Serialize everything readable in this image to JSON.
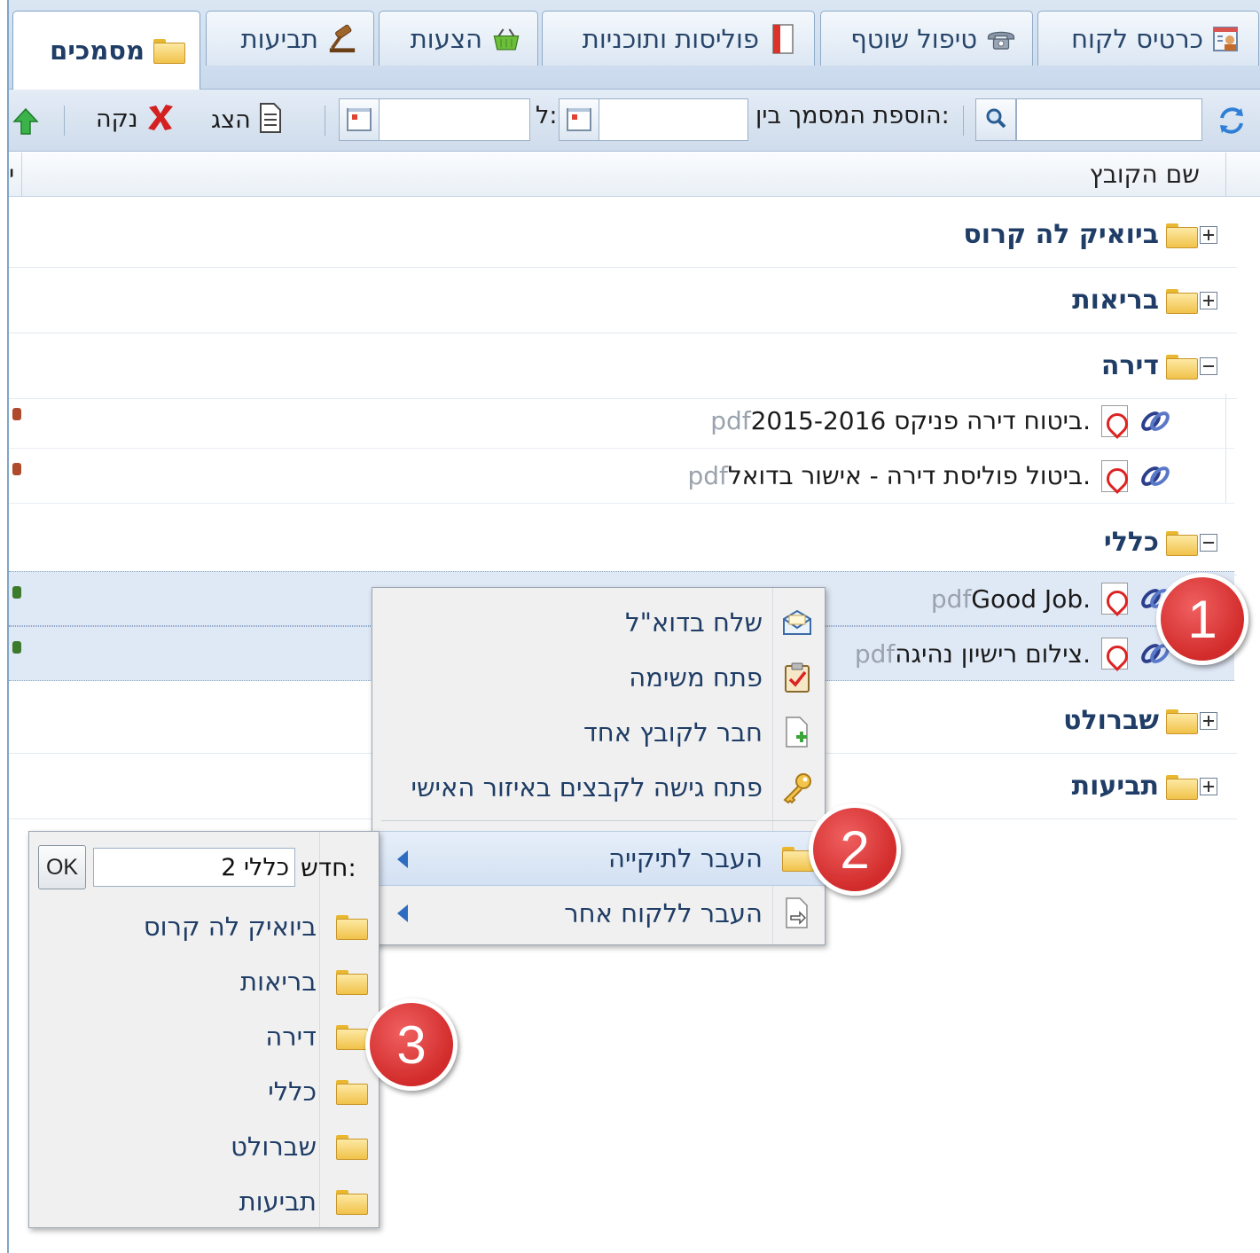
{
  "tabs": [
    {
      "label": "כרטיס לקוח",
      "icon": "customer-card-icon"
    },
    {
      "label": "טיפול שוטף",
      "icon": "phone-icon"
    },
    {
      "label": "פוליסות ותוכניות",
      "icon": "policy-book-icon"
    },
    {
      "label": "הצעות",
      "icon": "basket-icon"
    },
    {
      "label": "תביעות",
      "icon": "gavel-icon"
    },
    {
      "label": "מסמכים",
      "icon": "folder-icon",
      "active": true
    }
  ],
  "toolbar": {
    "date_range_label": "הוספת המסמך בין:",
    "to_label": "ל:",
    "show_label": "הצג",
    "clear_label": "נקה",
    "search_value": "",
    "from_date": "",
    "to_date": ""
  },
  "grid": {
    "column_title": "שם הקובץ",
    "left_column_fragment": "‫י‬"
  },
  "folders": [
    {
      "name": "ביואיק לה קרוס",
      "expanded": false
    },
    {
      "name": "בריאות",
      "expanded": false
    },
    {
      "name": "דירה",
      "expanded": true,
      "files": [
        {
          "name": "ביטוח דירה פניקס 2015-2016.",
          "ext": "pdf"
        },
        {
          "name": "ביטול פוליסת דירה - אישור בדואל.",
          "ext": "pdf"
        }
      ]
    },
    {
      "name": "כללי",
      "expanded": true,
      "files": [
        {
          "name": "Good Job.",
          "ext": "pdf"
        },
        {
          "name": "צילום רישיון נהיגה.",
          "ext": "pdf"
        }
      ]
    },
    {
      "name": "שברולט",
      "expanded": false
    },
    {
      "name": "תביעות",
      "expanded": false
    }
  ],
  "context_menu": {
    "items": [
      {
        "label": "שלח בדוא\"ל",
        "icon": "email-icon"
      },
      {
        "label": "פתח משימה",
        "icon": "task-clipboard-icon"
      },
      {
        "label": "חבר לקובץ אחד",
        "icon": "merge-file-icon"
      },
      {
        "label": "פתח גישה לקבצים באיזור האישי",
        "icon": "key-icon"
      },
      {
        "label": "העבר לתיקייה",
        "icon": "folder-icon",
        "highlighted": true,
        "has_submenu": true
      },
      {
        "label": "העבר ללקוח אחר",
        "icon": "move-file-icon",
        "has_submenu": true
      }
    ]
  },
  "submenu": {
    "new_label": "חדש:",
    "new_value": "כללי 2",
    "ok_label": "OK",
    "folders": [
      "ביואיק לה קרוס",
      "בריאות",
      "דירה",
      "כללי",
      "שברולט",
      "תביעות"
    ]
  },
  "callouts": [
    "1",
    "2",
    "3"
  ],
  "colors": {
    "tab_text": "#28466b",
    "folder_text": "#1f3d66",
    "selection": "#dfe8f5",
    "badge": "#d22b2b"
  }
}
